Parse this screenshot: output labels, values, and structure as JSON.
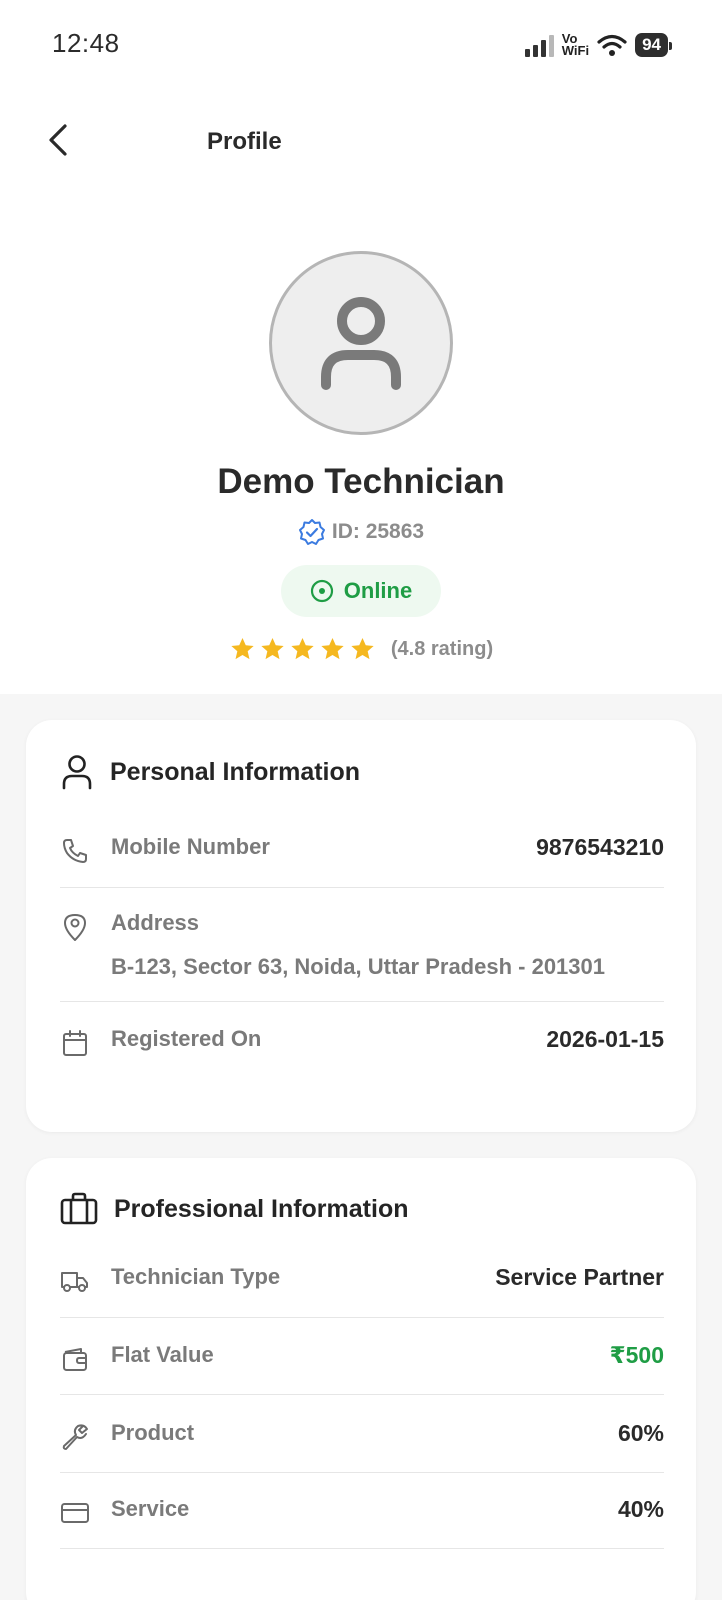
{
  "status_bar": {
    "time": "12:48",
    "vowifi_top": "Vo",
    "vowifi_bottom": "WiFi",
    "battery": "94"
  },
  "header": {
    "back_icon": "chevron-left-icon",
    "title": "Profile"
  },
  "profile": {
    "name": "Demo Technician",
    "id_text": "ID: 25863",
    "status": "Online",
    "rating_stars": 5,
    "rating_text": "(4.8 rating)"
  },
  "personal": {
    "title": "Personal Information",
    "mobile_label": "Mobile Number",
    "mobile_value": "9876543210",
    "address_label": "Address",
    "address_value": "B-123, Sector 63, Noida, Uttar Pradesh - 201301",
    "registered_label": "Registered On",
    "registered_value": "2026-01-15"
  },
  "professional": {
    "title": "Professional Information",
    "type_label": "Technician Type",
    "type_value": "Service Partner",
    "flat_label": "Flat Value",
    "flat_value": "₹500",
    "product_label": "Product",
    "product_value": "60%",
    "service_label": "Service",
    "service_value": "40%"
  },
  "colors": {
    "accent_green": "#1f9d45",
    "star": "#f5b820",
    "verified_blue": "#3b7be0"
  }
}
